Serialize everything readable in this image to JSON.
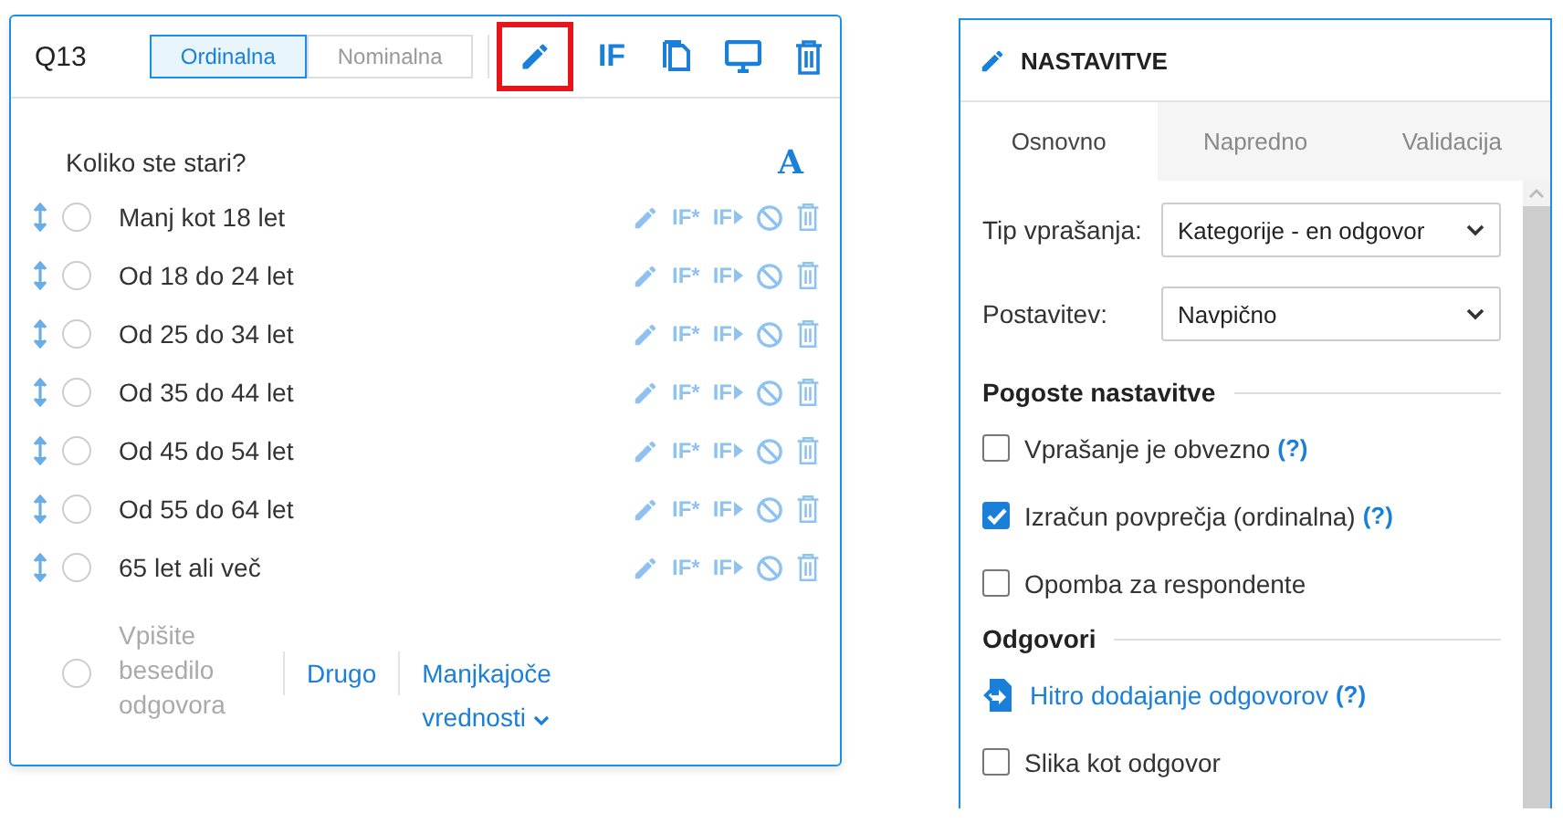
{
  "question_card": {
    "number": "Q13",
    "scale_toggle": [
      {
        "label": "Ordinalna",
        "selected": true
      },
      {
        "label": "Nominalna",
        "selected": false
      }
    ],
    "tools": [
      {
        "kind": "edit",
        "highlighted": true
      },
      {
        "kind": "if",
        "text": "IF",
        "highlighted": false
      },
      {
        "kind": "copy",
        "highlighted": false
      },
      {
        "kind": "monitor",
        "highlighted": false
      },
      {
        "kind": "trash",
        "highlighted": false
      }
    ],
    "question_text": "Koliko ste stari?",
    "font_button": "A",
    "answers": [
      {
        "text": "Manj kot 18 let",
        "if_star": "IF*",
        "if_next": "IF",
        "selected": false
      },
      {
        "text": "Od 18 do 24 let",
        "if_star": "IF*",
        "if_next": "IF",
        "selected": false
      },
      {
        "text": "Od 25 do 34 let",
        "if_star": "IF*",
        "if_next": "IF",
        "selected": false
      },
      {
        "text": "Od 35 do 44 let",
        "if_star": "IF*",
        "if_next": "IF",
        "selected": false
      },
      {
        "text": "Od 45 do 54 let",
        "if_star": "IF*",
        "if_next": "IF",
        "selected": false
      },
      {
        "text": "Od 55 do 64 let",
        "if_star": "IF*",
        "if_next": "IF",
        "selected": false
      },
      {
        "text": "65 let ali več",
        "if_star": "IF*",
        "if_next": "IF",
        "selected": false
      }
    ],
    "new_answer": {
      "placeholder": "Vpišite besedilo odgovora",
      "selected": false
    },
    "other_link": "Drugo",
    "missing_link": "Manjkajoče vrednosti"
  },
  "settings_panel": {
    "title": "NASTAVITVE",
    "tabs": [
      {
        "label": "Osnovno",
        "selected": true
      },
      {
        "label": "Napredno",
        "selected": false
      },
      {
        "label": "Validacija",
        "selected": false
      }
    ],
    "fields": [
      {
        "label": "Tip vprašanja:",
        "value": "Kategorije - en odgovor"
      },
      {
        "label": "Postavitev:",
        "value": "Navpično"
      }
    ],
    "sections": [
      {
        "title": "Pogoste nastavitve",
        "items": [
          {
            "kind": "checkbox",
            "label": "Vprašanje je obvezno",
            "help": "(?)",
            "checked": false
          },
          {
            "kind": "checkbox",
            "label": "Izračun povprečja (ordinalna)",
            "help": "(?)",
            "checked": true
          },
          {
            "kind": "checkbox",
            "label": "Opomba za respondente",
            "checked": false
          }
        ]
      },
      {
        "title": "Odgovori",
        "items": [
          {
            "kind": "link",
            "label": "Hitro dodajanje odgovorov",
            "help": "(?)"
          },
          {
            "kind": "checkbox",
            "label": "Slika kot odgovor",
            "checked": false
          }
        ]
      }
    ]
  }
}
